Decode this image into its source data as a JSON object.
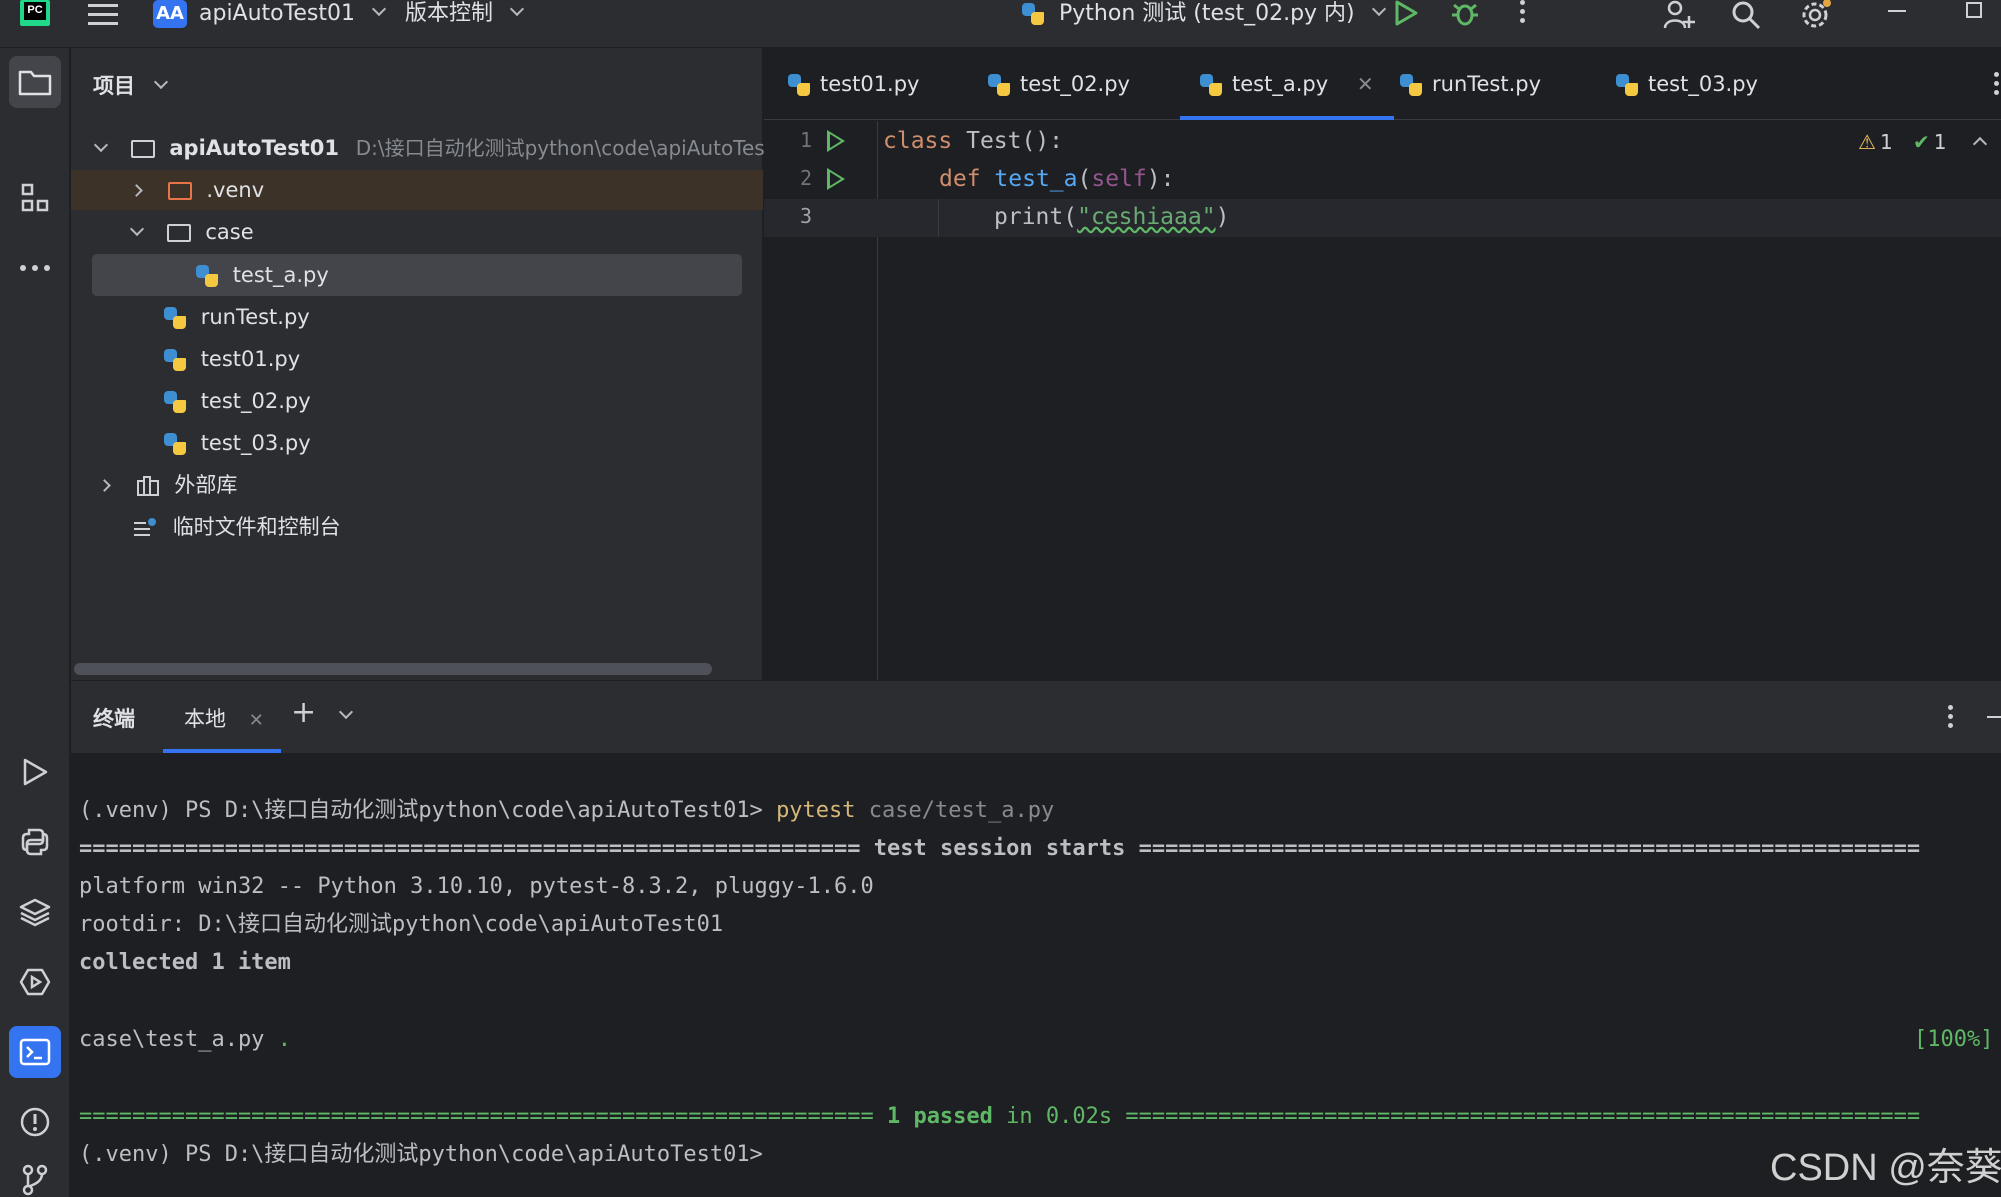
{
  "titlebar": {
    "logo_text": "PC",
    "project_badge": "AA",
    "project_name": "apiAutoTest01",
    "vcs_menu": "版本控制",
    "run_config": "Python 测试 (test_02.py 内)"
  },
  "project_panel": {
    "title": "项目",
    "root_name": "apiAutoTest01",
    "root_path": "D:\\接口自动化测试python\\code\\apiAutoTest",
    "items": [
      {
        "label": ".venv"
      },
      {
        "label": "case"
      },
      {
        "label": "test_a.py"
      },
      {
        "label": "runTest.py"
      },
      {
        "label": "test01.py"
      },
      {
        "label": "test_02.py"
      },
      {
        "label": "test_03.py"
      },
      {
        "label": "外部库"
      },
      {
        "label": "临时文件和控制台"
      }
    ]
  },
  "editor": {
    "tabs": [
      {
        "label": "test01.py"
      },
      {
        "label": "test_02.py"
      },
      {
        "label": "test_a.py"
      },
      {
        "label": "runTest.py"
      },
      {
        "label": "test_03.py"
      }
    ],
    "line_numbers": [
      "1",
      "2",
      "3"
    ],
    "code": {
      "l1_kw": "class",
      "l1_rest": " Test():",
      "l2_kw": "def",
      "l2_fn": "test_a",
      "l2_open": "(",
      "l2_self": "self",
      "l2_close": "):",
      "l3_fn": "print(",
      "l3_str": "\"ceshiaaa\"",
      "l3_close": ")"
    },
    "inspections": {
      "warnings": "1",
      "typos": "1"
    }
  },
  "terminal": {
    "title": "终端",
    "tab_local": "本地",
    "lines": {
      "cmd_prompt": "(.venv) PS D:\\接口自动化测试python\\code\\apiAutoTest01> ",
      "cmd_word": "pytest",
      "cmd_arg": " case/test_a.py",
      "session_left": "=========================================================== ",
      "session_text": "test session starts",
      "session_right": " ===========================================================",
      "platform": "platform win32 -- Python 3.10.10, pytest-8.3.2, pluggy-1.6.0",
      "rootdir": "rootdir: D:\\接口自动化测试python\\code\\apiAutoTest01",
      "collected": "collected 1 item",
      "result_file": "case\\test_a.py ",
      "result_dot": ".",
      "percent": "[100%]",
      "passed_left": "============================================================ ",
      "passed_text": "1 passed",
      "passed_in": " in 0.02s",
      "passed_right": " ============================================================",
      "prompt_end": "(.venv) PS D:\\接口自动化测试python\\code\\apiAutoTest01>"
    }
  },
  "watermark": "CSDN @奈葵"
}
